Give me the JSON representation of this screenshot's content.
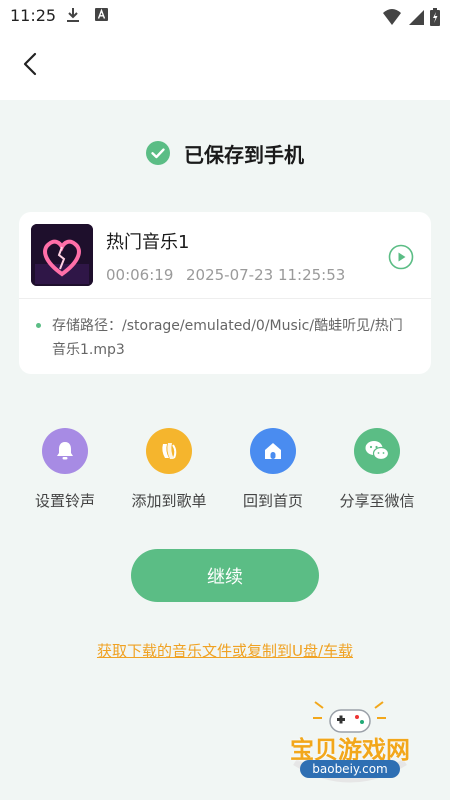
{
  "status_bar": {
    "time": "11:25"
  },
  "saved_notice": "已保存到手机",
  "song": {
    "title": "热门音乐1",
    "duration": "00:06:19",
    "datetime": "2025-07-23 11:25:53",
    "path_label": "存储路径：/storage/emulated/0/Music/酷蛙听见/热门音乐1.mp3"
  },
  "actions": [
    {
      "label": "设置铃声",
      "icon": "bell-icon",
      "color": "#a78be4"
    },
    {
      "label": "添加到歌单",
      "icon": "playlist-add-icon",
      "color": "#f5b52d"
    },
    {
      "label": "回到首页",
      "icon": "home-icon",
      "color": "#4a8cf0"
    },
    {
      "label": "分享至微信",
      "icon": "wechat-icon",
      "color": "#5bbd85"
    }
  ],
  "continue_label": "继续",
  "help_link": "获取下载的音乐文件或复制到U盘/车载",
  "watermark": {
    "title": "宝贝游戏网",
    "url": "baobeiy.com"
  },
  "colors": {
    "accent": "#5bbd85",
    "link": "#f0a223",
    "background": "#f1f6f4"
  }
}
